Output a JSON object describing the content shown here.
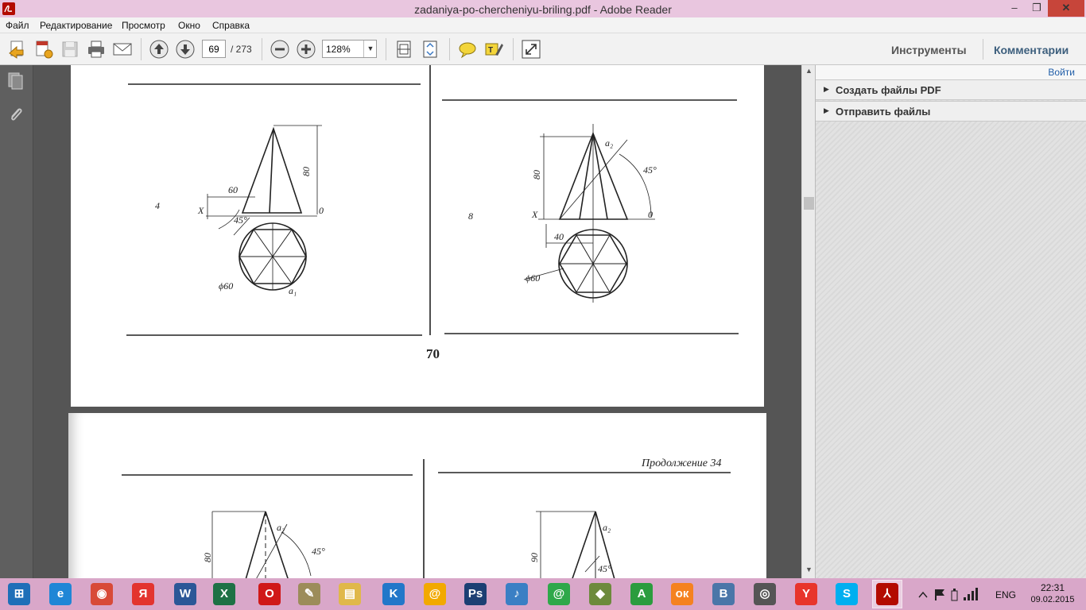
{
  "window": {
    "title": "zadaniya-po-chercheniyu-briling.pdf - Adobe Reader",
    "minimize": "‒",
    "maximize": "❐",
    "close": "✕"
  },
  "menu": [
    "Файл",
    "Редактирование",
    "Просмотр",
    "Окно",
    "Справка"
  ],
  "toolbar": {
    "page_current": "69",
    "page_total": "/ 273",
    "zoom": "128%",
    "zoom_arrow": "▼",
    "tools_label": "Инструменты",
    "comments_label": "Комментарии",
    "icons": [
      "create-pdf-icon",
      "save-icon",
      "print-icon",
      "email-icon",
      "prev-page-icon",
      "next-page-icon",
      "zoom-out-icon",
      "zoom-in-icon",
      "fit-page-icon",
      "fit-width-icon",
      "sticky-note-icon",
      "highlight-icon",
      "fullscreen-icon"
    ]
  },
  "nav_panel": {
    "icons": [
      "pages-icon",
      "attachments-icon"
    ]
  },
  "right_pane": {
    "signin": "Войти",
    "sections": [
      {
        "label": "Создать файлы PDF"
      },
      {
        "label": "Отправить файлы"
      }
    ]
  },
  "document": {
    "page1": {
      "page_number": "70",
      "figures": [
        {
          "index": "4",
          "dim_height": "80",
          "dim_width": "60",
          "angle": "45°",
          "diameter": "ϕ60",
          "x_label": "X",
          "zero_label": "0",
          "point_label": "a₁"
        },
        {
          "index": "8",
          "dim_height": "80",
          "dim_width": "40",
          "angle": "45°",
          "diameter": "ϕ60",
          "x_label": "X",
          "zero_label": "0",
          "point_label": "a₂"
        }
      ]
    },
    "page2": {
      "header_label": "Продолжение 34",
      "figures": [
        {
          "dim_height": "80",
          "angle": "45°",
          "point_label": "a₂"
        },
        {
          "dim_height": "90",
          "angle": "45°",
          "point_label": "a₂"
        }
      ]
    }
  },
  "scrollbar": {
    "up": "▲",
    "down": "▼"
  },
  "taskbar": {
    "language": "ENG",
    "time": "22:31",
    "date": "09.02.2015",
    "apps": [
      {
        "name": "start",
        "glyph": "⊞",
        "color": "#1e6fb8"
      },
      {
        "name": "internet-explorer",
        "glyph": "e",
        "color": "#1f86d6"
      },
      {
        "name": "chrome",
        "glyph": "◉",
        "color": "#d84a38"
      },
      {
        "name": "yandex",
        "glyph": "Я",
        "color": "#e3342f"
      },
      {
        "name": "word",
        "glyph": "W",
        "color": "#2b5797"
      },
      {
        "name": "excel",
        "glyph": "X",
        "color": "#1e7145"
      },
      {
        "name": "opera",
        "glyph": "O",
        "color": "#d01818"
      },
      {
        "name": "notes",
        "glyph": "✎",
        "color": "#9c8c5a"
      },
      {
        "name": "explorer",
        "glyph": "▤",
        "color": "#e0b84a"
      },
      {
        "name": "k-app",
        "glyph": "K",
        "color": "#2277c9"
      },
      {
        "name": "mail-agent",
        "glyph": "@",
        "color": "#f2a900"
      },
      {
        "name": "photoshop",
        "glyph": "Ps",
        "color": "#1c3f73"
      },
      {
        "name": "sound",
        "glyph": "♪",
        "color": "#3a7fc4"
      },
      {
        "name": "icq",
        "glyph": "@",
        "color": "#2fa84a"
      },
      {
        "name": "shield",
        "glyph": "◆",
        "color": "#6c8a3c"
      },
      {
        "name": "a-app",
        "glyph": "A",
        "color": "#2b9c3e"
      },
      {
        "name": "odnoklassniki",
        "glyph": "ок",
        "color": "#f58220"
      },
      {
        "name": "vk",
        "glyph": "B",
        "color": "#4a76a8"
      },
      {
        "name": "browser",
        "glyph": "◎",
        "color": "#555555"
      },
      {
        "name": "yandex-browser",
        "glyph": "Y",
        "color": "#e8352b"
      },
      {
        "name": "skype",
        "glyph": "S",
        "color": "#00aff0"
      },
      {
        "name": "adobe-reader",
        "glyph": "⅄",
        "color": "#b30b00"
      }
    ]
  }
}
